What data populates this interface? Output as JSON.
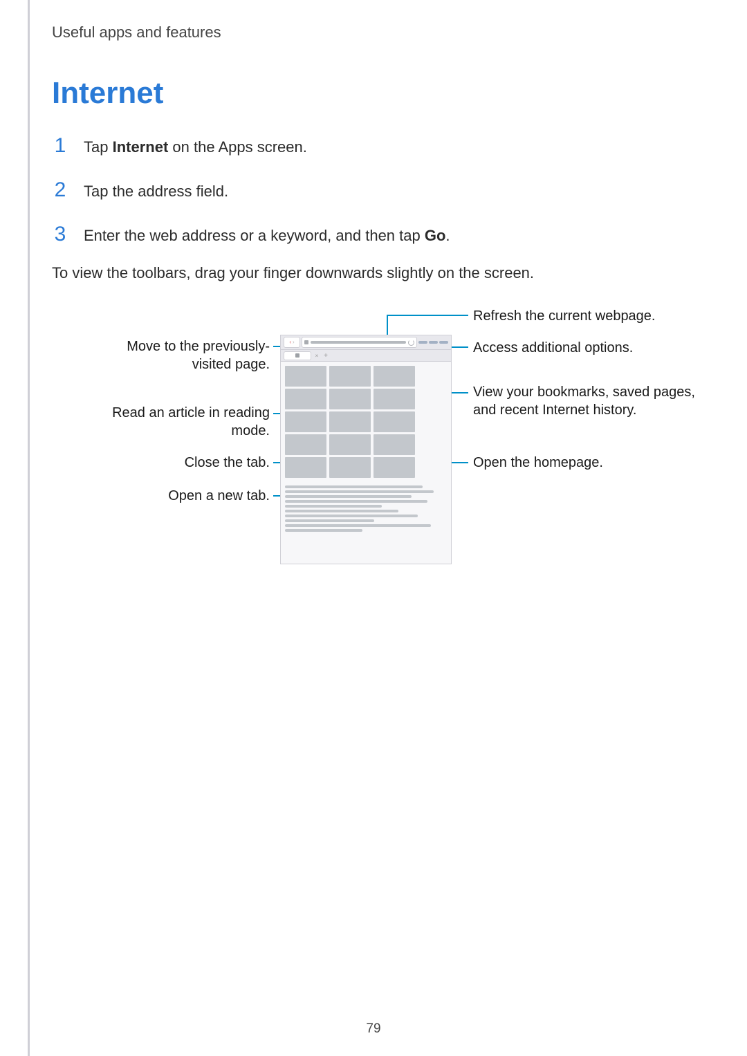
{
  "running_header": "Useful apps and features",
  "title": "Internet",
  "steps": [
    {
      "num": "1",
      "pre": "Tap ",
      "bold": "Internet",
      "post": " on the Apps screen."
    },
    {
      "num": "2",
      "pre": "Tap the address field.",
      "bold": "",
      "post": ""
    },
    {
      "num": "3",
      "pre": "Enter the web address or a keyword, and then tap ",
      "bold": "Go",
      "post": "."
    }
  ],
  "paragraph": "To view the toolbars, drag your finger downwards slightly on the screen.",
  "callouts": {
    "left": {
      "nav": "Move to the previously-visited page.",
      "reader": "Read an article in reading mode.",
      "close_tab": "Close the tab.",
      "new_tab": "Open a new tab."
    },
    "right": {
      "refresh": "Refresh the current webpage.",
      "options": "Access additional options.",
      "bookmarks": "View your bookmarks, saved pages, and recent Internet history.",
      "homepage": "Open the homepage."
    }
  },
  "page_number": "79"
}
